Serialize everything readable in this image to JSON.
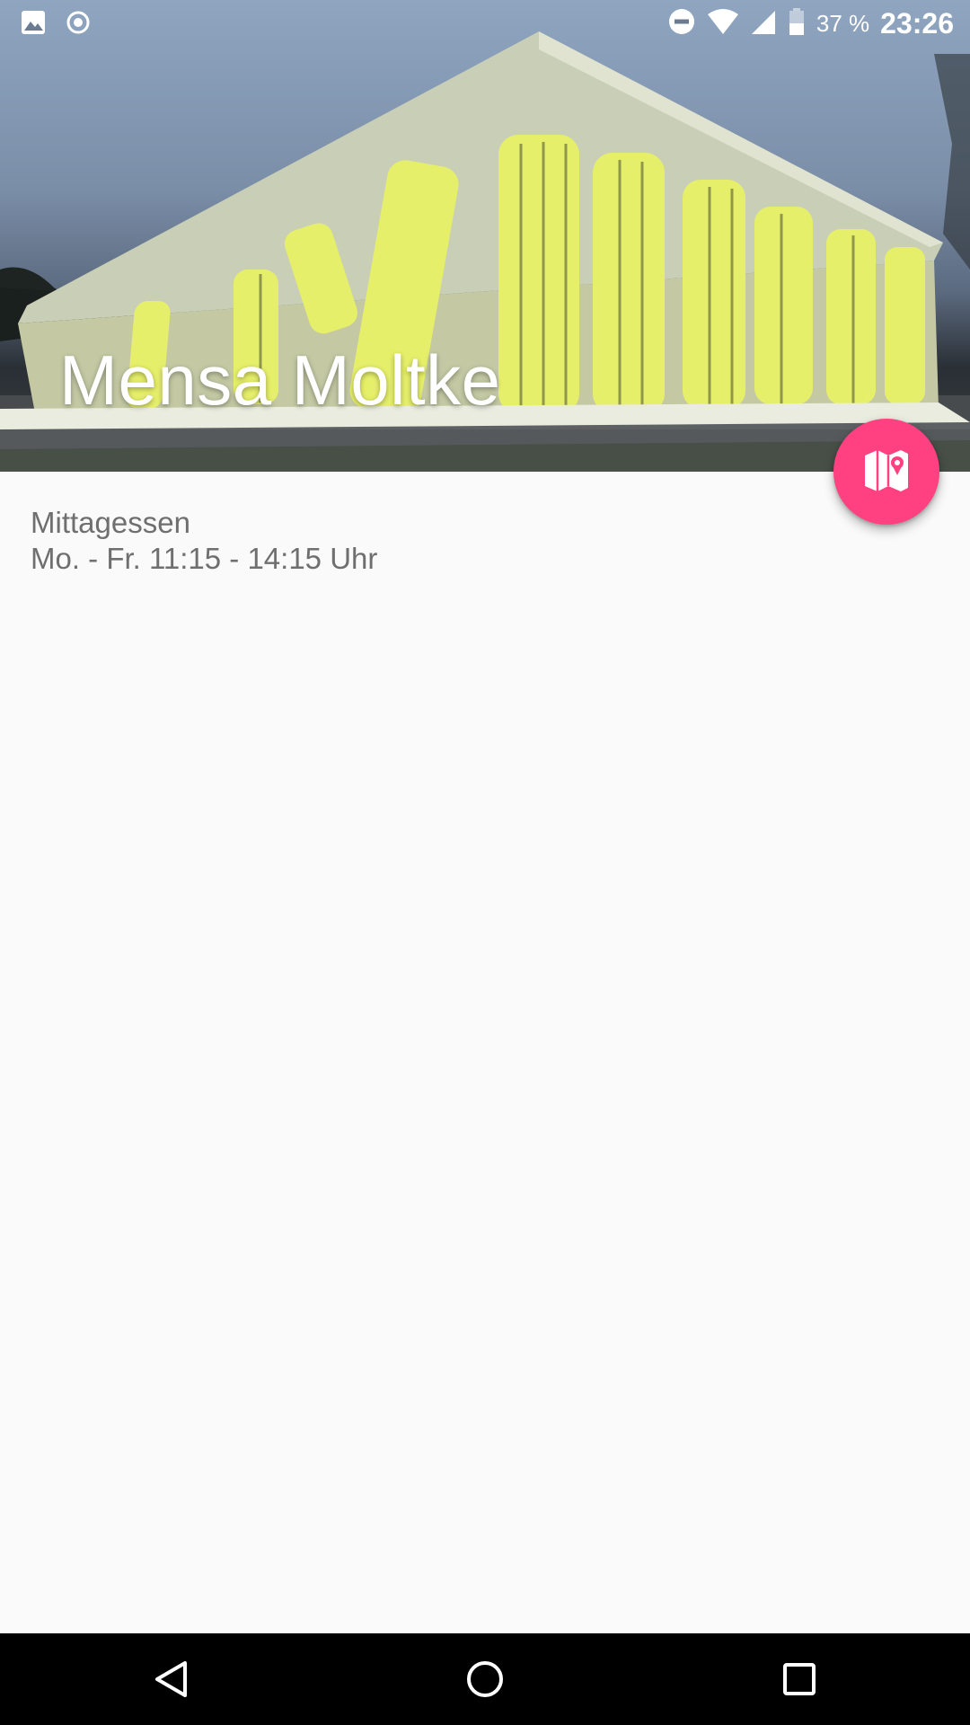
{
  "status_bar": {
    "battery_percent": "37 %",
    "clock": "23:26",
    "left_icons": [
      "image-icon",
      "record-icon"
    ],
    "right_icons": [
      "dnd-icon",
      "wifi-icon",
      "signal-icon",
      "battery-icon"
    ]
  },
  "header": {
    "title": "Mensa Moltke"
  },
  "fab": {
    "icon": "map-icon",
    "color": "#ff4081"
  },
  "info": {
    "label": "Mittagessen",
    "hours": "Mo. - Fr. 11:15 - 14:15 Uhr"
  },
  "nav_bar": {
    "buttons": [
      "back-icon",
      "home-icon",
      "recents-icon"
    ]
  },
  "colors": {
    "accent": "#ff4081",
    "background": "#fafafa",
    "text_secondary": "#6f6f6f"
  }
}
